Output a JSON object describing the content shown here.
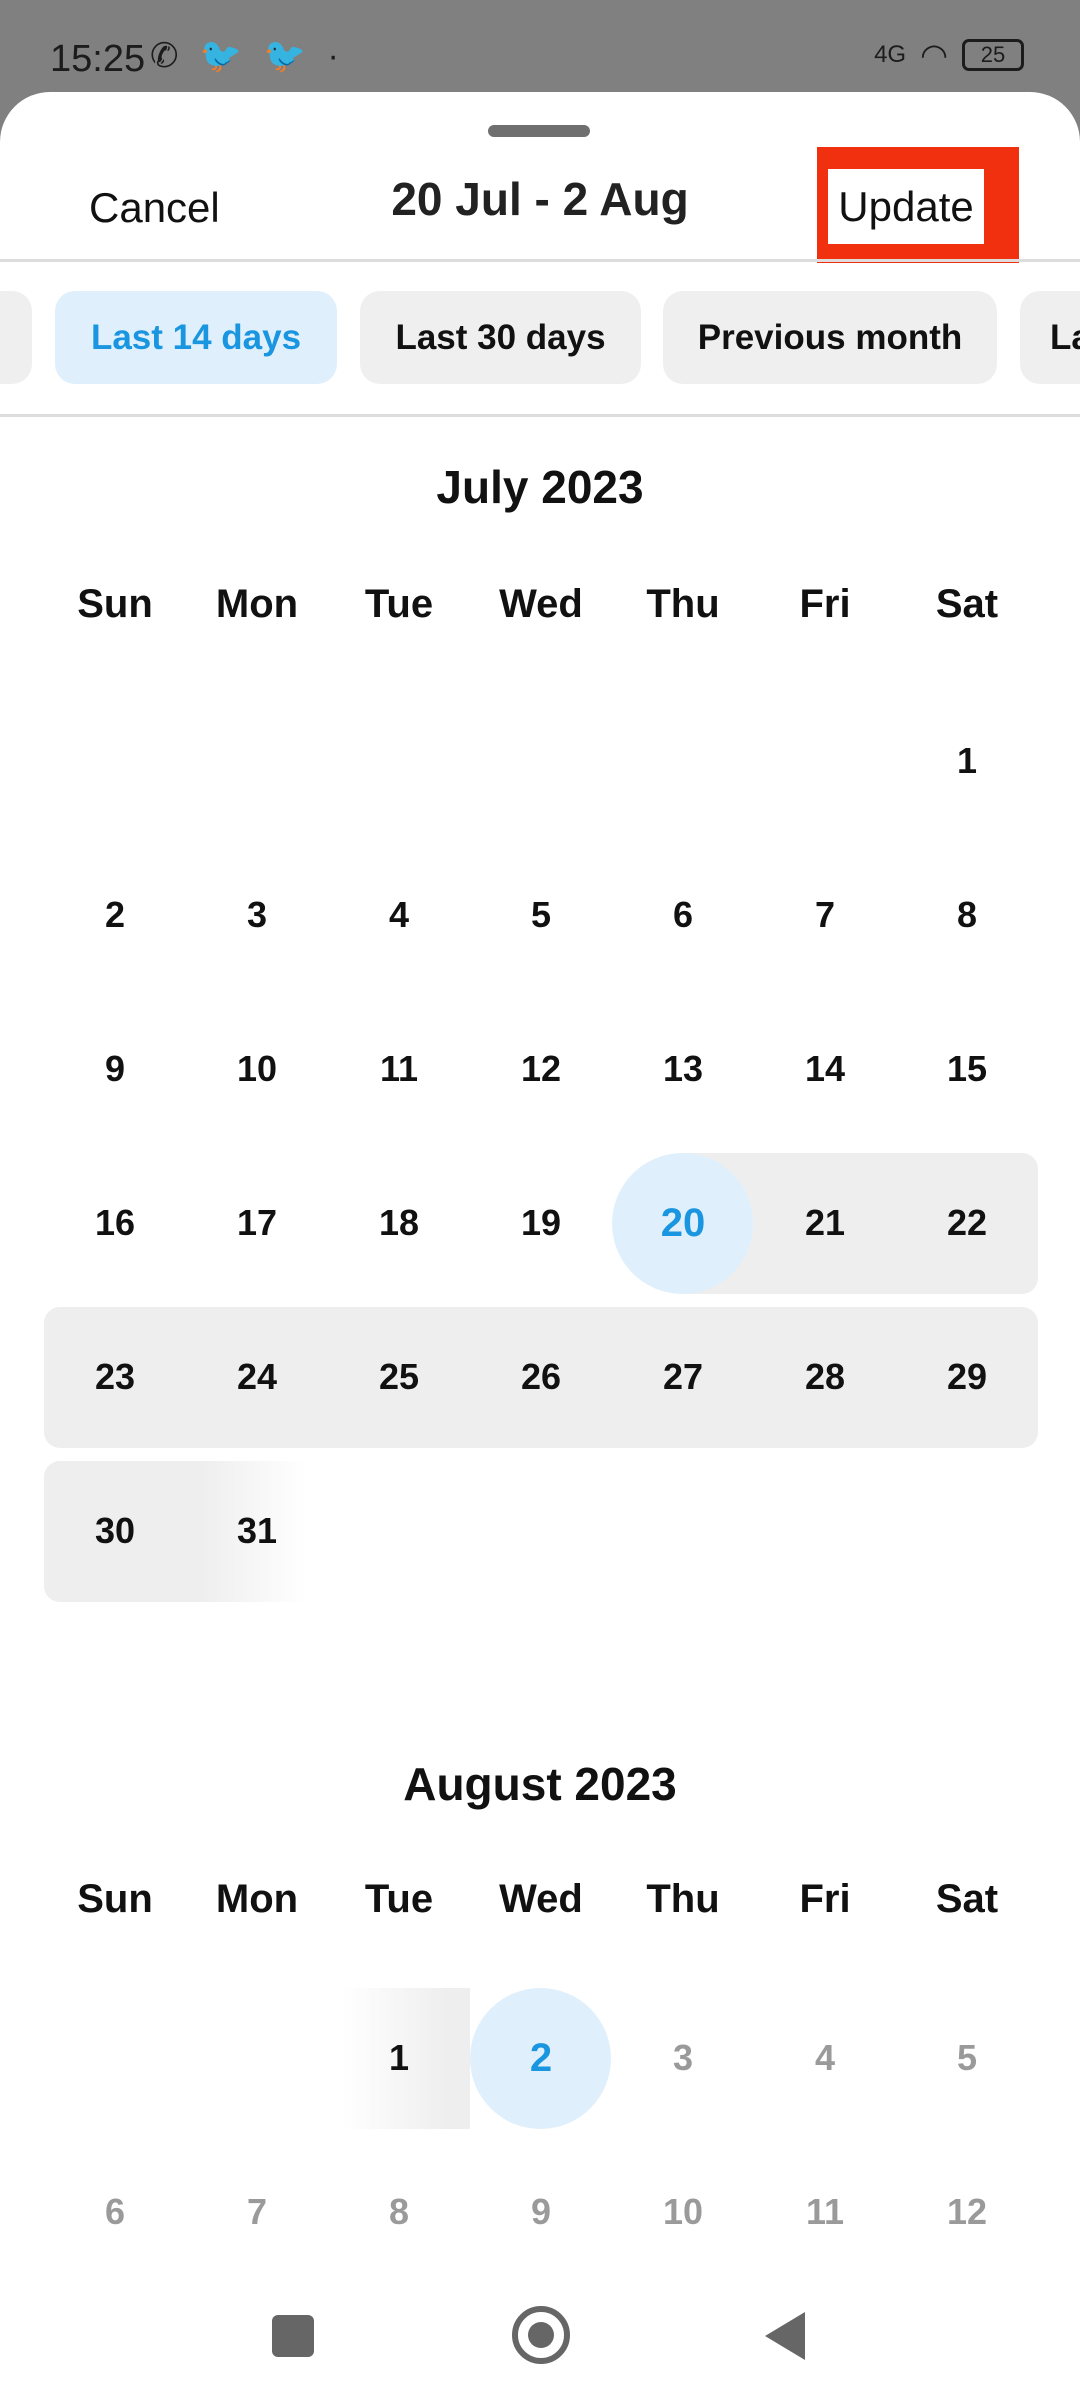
{
  "status_bar": {
    "time": "15:25",
    "left_icons": [
      "whatsapp-icon",
      "twitter-icon",
      "twitter-icon",
      "dot"
    ],
    "network": "4G",
    "battery": "25"
  },
  "header": {
    "cancel_label": "Cancel",
    "title": "20 Jul - 2 Aug",
    "update_label": "Update",
    "highlight_color": "#f0300f"
  },
  "presets": [
    {
      "label": "",
      "active": false
    },
    {
      "label": "Last 14 days",
      "active": true
    },
    {
      "label": "Last 30 days",
      "active": false
    },
    {
      "label": "Previous month",
      "active": false
    },
    {
      "label": "La",
      "active": false
    }
  ],
  "colors": {
    "accent": "#1a95e0",
    "selected_bg": "#dff0fc",
    "range_bg": "#eeeeee"
  },
  "months": [
    {
      "title": "July 2023",
      "weekdays": [
        "Sun",
        "Mon",
        "Tue",
        "Wed",
        "Thu",
        "Fri",
        "Sat"
      ],
      "weeks": [
        [
          null,
          null,
          null,
          null,
          null,
          null,
          1
        ],
        [
          2,
          3,
          4,
          5,
          6,
          7,
          8
        ],
        [
          9,
          10,
          11,
          12,
          13,
          14,
          15
        ],
        [
          16,
          17,
          18,
          19,
          20,
          21,
          22
        ],
        [
          23,
          24,
          25,
          26,
          27,
          28,
          29
        ],
        [
          30,
          31,
          null,
          null,
          null,
          null,
          null
        ]
      ],
      "selection_start": 20,
      "range_until_month_end": true
    },
    {
      "title": "August 2023",
      "weekdays": [
        "Sun",
        "Mon",
        "Tue",
        "Wed",
        "Thu",
        "Fri",
        "Sat"
      ],
      "weeks": [
        [
          null,
          null,
          1,
          2,
          3,
          4,
          5
        ],
        [
          6,
          7,
          8,
          9,
          10,
          11,
          12
        ]
      ],
      "selection_end": 2,
      "disabled_after": 2
    }
  ],
  "nav_bar": {
    "buttons": [
      "recents",
      "home",
      "back"
    ]
  }
}
